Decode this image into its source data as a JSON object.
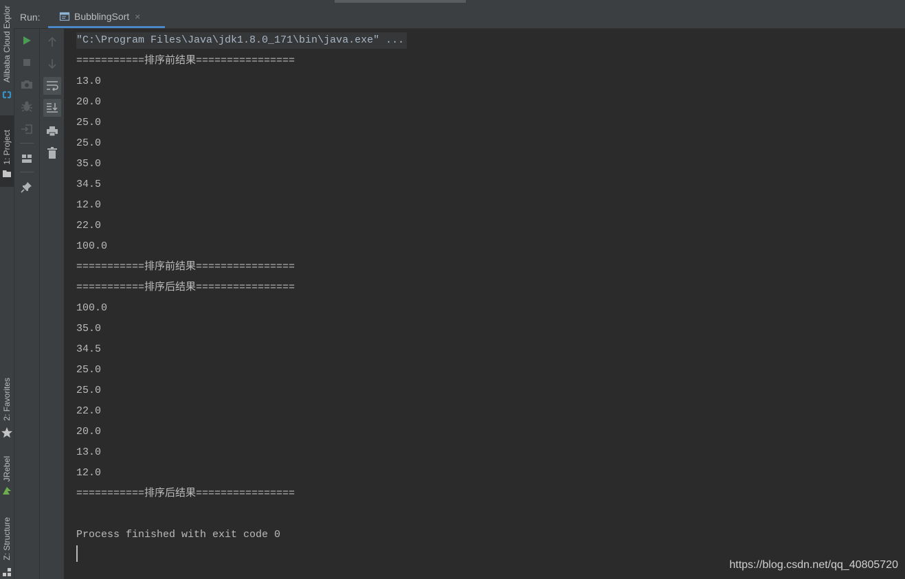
{
  "side_tabs": {
    "alibaba": "Alibaba Cloud Explor",
    "project": "1: Project",
    "favorites": "2: Favorites",
    "jrebel": "JRebel",
    "structure": "Z: Structure"
  },
  "run_panel": {
    "label": "Run:",
    "tab_name": "BubblingSort",
    "close_glyph": "×"
  },
  "toolbar": {
    "rerun": "play-icon",
    "stop": "stop-icon",
    "dump_threads": "camera-icon",
    "debug": "bug-icon",
    "restore_layout": "exit-icon",
    "layout": "layout-icon",
    "pin": "pin-icon",
    "up": "arrow-up-icon",
    "down": "arrow-down-icon",
    "soft_wrap": "soft-wrap-icon",
    "scroll_to_end": "scroll-to-end-icon",
    "print": "print-icon",
    "clear": "trash-icon"
  },
  "console": {
    "command": "\"C:\\Program Files\\Java\\jdk1.8.0_171\\bin\\java.exe\" ...",
    "lines": [
      "===========排序前结果================",
      "13.0",
      "20.0",
      "25.0",
      "25.0",
      "35.0",
      "34.5",
      "12.0",
      "22.0",
      "100.0",
      "===========排序前结果================",
      "===========排序后结果================",
      "100.0",
      "35.0",
      "34.5",
      "25.0",
      "25.0",
      "22.0",
      "20.0",
      "13.0",
      "12.0",
      "===========排序后结果================",
      "",
      "Process finished with exit code 0"
    ]
  },
  "watermark": "https://blog.csdn.net/qq_40805720"
}
